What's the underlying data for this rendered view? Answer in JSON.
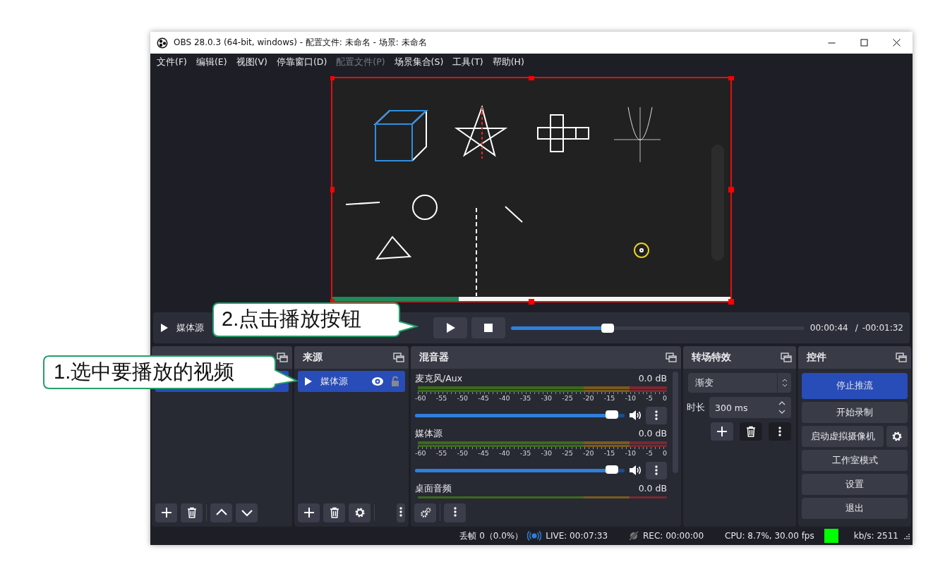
{
  "window": {
    "title": "OBS 28.0.3 (64-bit, windows) - 配置文件: 未命名 - 场景: 未命名"
  },
  "menu": [
    {
      "label": "文件(F)",
      "disabled": false
    },
    {
      "label": "编辑(E)",
      "disabled": false
    },
    {
      "label": "视图(V)",
      "disabled": false
    },
    {
      "label": "停靠窗口(D)",
      "disabled": false
    },
    {
      "label": "配置文件(P)",
      "disabled": true
    },
    {
      "label": "场景集合(S)",
      "disabled": false
    },
    {
      "label": "工具(T)",
      "disabled": false
    },
    {
      "label": "帮助(H)",
      "disabled": false
    }
  ],
  "media_controls": {
    "source": "媒体源",
    "seek": {
      "level": 0.33
    },
    "time": "00:00:44",
    "separator": "/",
    "remaining": "-00:01:32"
  },
  "scenes": {
    "rows": [
      {
        "selected": true
      }
    ]
  },
  "sources": {
    "title": "来源",
    "items": [
      {
        "label": "媒体源",
        "selected": true,
        "visible": true,
        "locked": false
      }
    ]
  },
  "mixer": {
    "title": "混音器",
    "channels": [
      {
        "name": "麦克风/Aux",
        "reading": "0.0 dB",
        "scale": [
          "-60",
          "-55",
          "-50",
          "-45",
          "-40",
          "-35",
          "-30",
          "-25",
          "-20",
          "-15",
          "-10",
          "-5",
          "0"
        ],
        "level": 0.97,
        "muted": false
      },
      {
        "name": "媒体源",
        "reading": "0.0 dB",
        "scale": [
          "-60",
          "-55",
          "-50",
          "-45",
          "-40",
          "-35",
          "-30",
          "-25",
          "-20",
          "-15",
          "-10",
          "-5",
          "0"
        ],
        "level": 0.97,
        "muted": false
      },
      {
        "name": "桌面音频",
        "reading": "0.0 dB"
      }
    ]
  },
  "transitions": {
    "title": "转场特效",
    "transition": "渐变",
    "duration_label": "时长",
    "duration": "300 ms"
  },
  "controls": {
    "title": "控件",
    "buttons": [
      {
        "label": "停止推流",
        "active": true,
        "kind": "plain"
      },
      {
        "label": "开始录制",
        "active": false,
        "kind": "plain"
      },
      {
        "label": "启动虚拟摄像机",
        "active": false,
        "kind": "with_settings"
      },
      {
        "label": "工作室模式",
        "active": false,
        "kind": "plain"
      },
      {
        "label": "设置",
        "active": false,
        "kind": "plain"
      },
      {
        "label": "退出",
        "active": false,
        "kind": "plain"
      }
    ]
  },
  "status_bar": {
    "dropped": "丢帧 0（0.0%）",
    "live": "LIVE: 00:07:33",
    "rec": "REC: 00:00:00",
    "cpu": "CPU: 8.7%, 30.00 fps",
    "kbps": "kb/s: 2511"
  },
  "callouts": [
    {
      "text": "1.选中要播放的视频"
    },
    {
      "text": "2.点击播放按钮"
    }
  ]
}
